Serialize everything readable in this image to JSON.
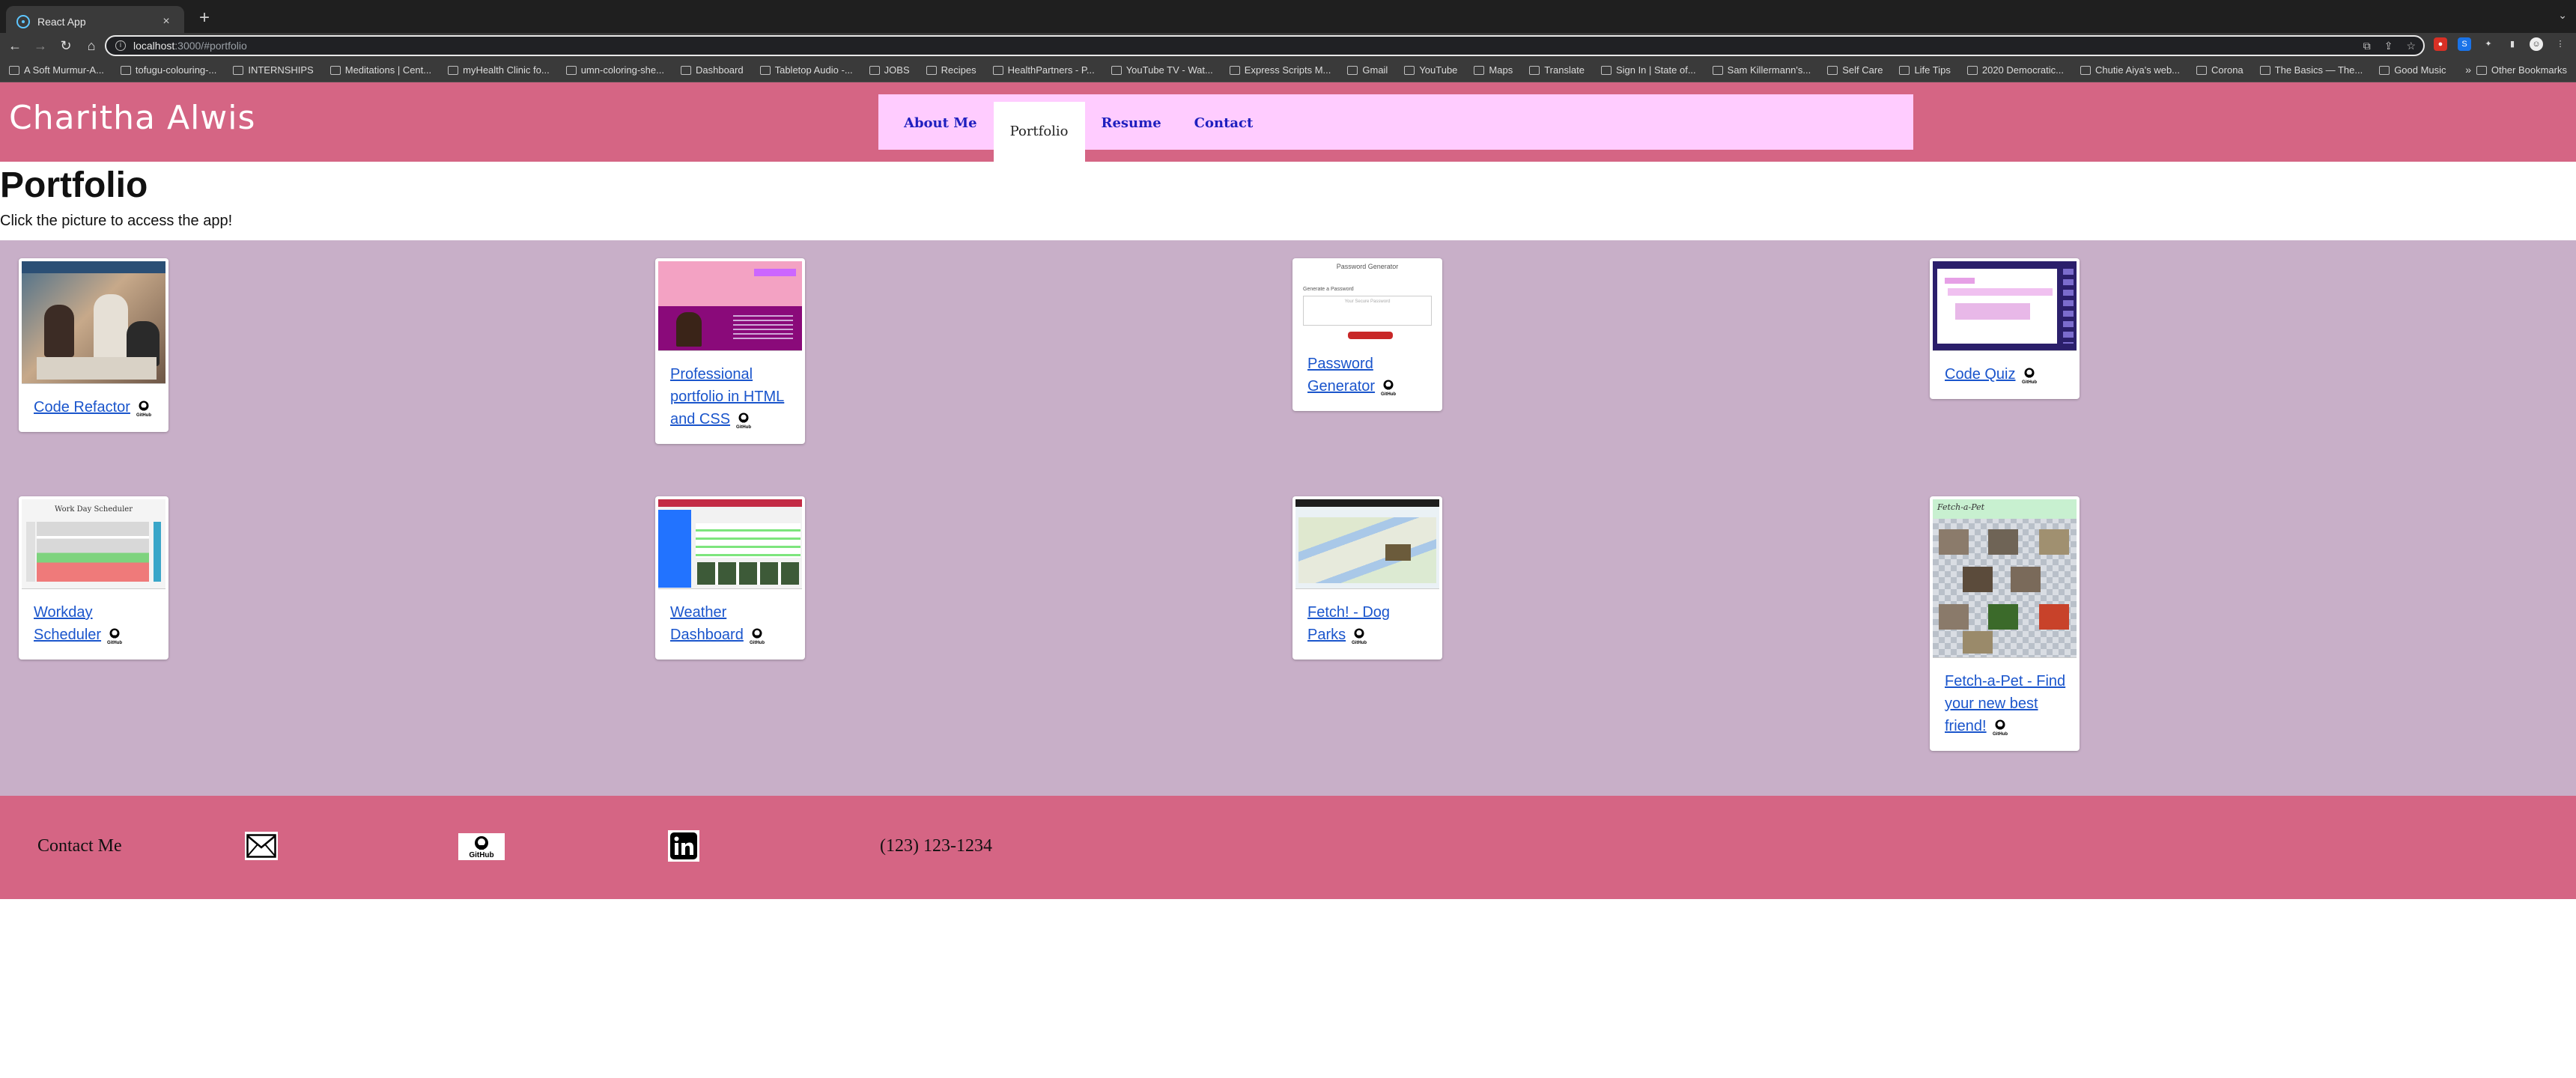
{
  "browser": {
    "tab_title": "React App",
    "tab_close": "×",
    "new_tab": "+",
    "url_host": "localhost",
    "url_rest": ":3000/#portfolio",
    "bookmarks": [
      "A Soft Murmur-A...",
      "tofugu-colouring-...",
      "INTERNSHIPS",
      "Meditations | Cent...",
      "myHealth Clinic fo...",
      "umn-coloring-she...",
      "Dashboard",
      "Tabletop Audio -...",
      "JOBS",
      "Recipes",
      "HealthPartners - P...",
      "YouTube TV - Wat...",
      "Express Scripts M...",
      "Gmail",
      "YouTube",
      "Maps",
      "Translate",
      "Sign In | State of...",
      "Sam Killermann's...",
      "Self Care",
      "Life Tips",
      "2020 Democratic...",
      "Chutie Aiya's web...",
      "Corona",
      "The Basics — The...",
      "Good Music"
    ],
    "bookmarks_more": "»",
    "other_bookmarks": "Other Bookmarks"
  },
  "header": {
    "site_name": "Charitha Alwis",
    "nav": [
      "About Me",
      "Portfolio",
      "Resume",
      "Contact"
    ],
    "active_nav": "Portfolio"
  },
  "main": {
    "heading": "Portfolio",
    "subtitle": "Click the picture to access the app!"
  },
  "projects": [
    {
      "title": "Code Refactor",
      "thumbnail": "refactor"
    },
    {
      "title": "Professional portfolio in HTML and CSS",
      "thumbnail": "portfolio"
    },
    {
      "title": "Password Generator",
      "thumbnail": "password"
    },
    {
      "title": "Code Quiz",
      "thumbnail": "quiz"
    },
    {
      "title": "Workday Scheduler",
      "thumbnail": "workday"
    },
    {
      "title": "Weather Dashboard",
      "thumbnail": "weather"
    },
    {
      "title": "Fetch! - Dog Parks",
      "thumbnail": "fetch"
    },
    {
      "title": "Fetch-a-Pet - Find your new best friend!",
      "thumbnail": "pet"
    }
  ],
  "thumb_text": {
    "password_title": "Password Generator",
    "password_label": "Generate a Password",
    "password_placeholder": "Your Secure Password",
    "workday_heading": "Work Day Scheduler",
    "pet_heading": "Fetch-a-Pet",
    "github_badge": "GitHub"
  },
  "footer": {
    "contact_label": "Contact Me",
    "icons": [
      "mail-icon",
      "github-icon",
      "linkedin-icon"
    ],
    "phone": "(123) 123-1234"
  },
  "colors": {
    "header_bg": "#d56584",
    "nav_bg": "#ffccff",
    "gallery_bg": "#c8afc8",
    "link": "#1a55cc"
  }
}
